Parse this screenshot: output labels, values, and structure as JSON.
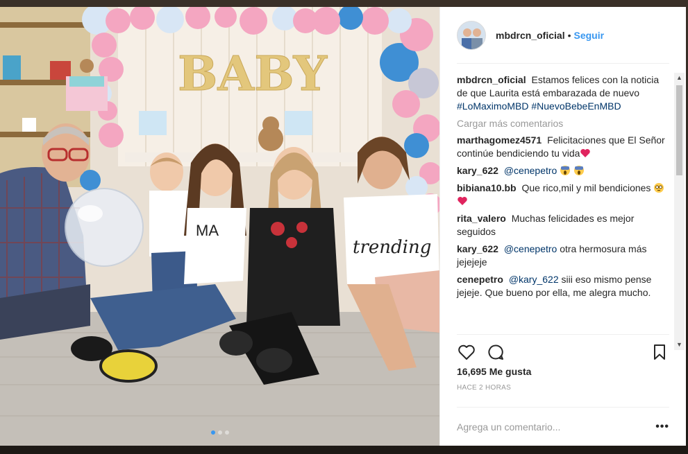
{
  "post": {
    "username": "mbdrcn_oficial",
    "separator": "•",
    "follow_label": "Seguir",
    "caption_text": "Estamos felices con la noticia de que Laurita está embarazada de nuevo",
    "caption_tags": [
      "#LoMaximoMBD",
      "#NuevoBebeEnMBD"
    ],
    "photo_sign_text": "BABY",
    "photo_shirt_text": "trending",
    "photo_shirt_text2": "MA"
  },
  "load_more_label": "Cargar más comentarios",
  "comments": [
    {
      "user": "marthagomez4571",
      "text": "Felicitaciones que El Señor continúe bendiciendo tu vida",
      "mention": "",
      "emoji": [
        "heart"
      ]
    },
    {
      "user": "kary_622",
      "text": "",
      "mention": "@cenepetro",
      "emoji": [
        "scream",
        "scream"
      ]
    },
    {
      "user": "bibiana10.bb",
      "text": "Que rico,mil y mil bendiciones",
      "mention": "",
      "emoji": [
        "flushed",
        "heart"
      ]
    },
    {
      "user": "rita_valero",
      "text": "Muchas felicidades es mejor seguidos",
      "mention": "",
      "emoji": []
    },
    {
      "user": "kary_622",
      "text": "otra hermosura más jejejeje",
      "mention": "@cenepetro",
      "emoji": []
    },
    {
      "user": "cenepetro",
      "text": "siii eso mismo pense jejeje. Que bueno por ella, me alegra mucho.",
      "mention": "@kary_622",
      "emoji": []
    }
  ],
  "likes_text": "16,695 Me gusta",
  "time_text": "HACE 2 HORAS",
  "add_comment_placeholder": "Agrega un comentario...",
  "more_options_label": "•••",
  "icons": {
    "like": "heart-outline-icon",
    "comment": "speech-bubble-icon",
    "save": "bookmark-icon",
    "scroll_up": "▲",
    "scroll_down": "▼"
  },
  "colors": {
    "link_blue": "#3897f0",
    "hashtag": "#003569",
    "secondary_text": "#999999",
    "text": "#262626",
    "heart_red": "#e0245e",
    "balloon_pink": "#f4a6c1",
    "balloon_blue": "#3f8fd4"
  },
  "carousel": {
    "count": 3,
    "active_index": 0
  }
}
